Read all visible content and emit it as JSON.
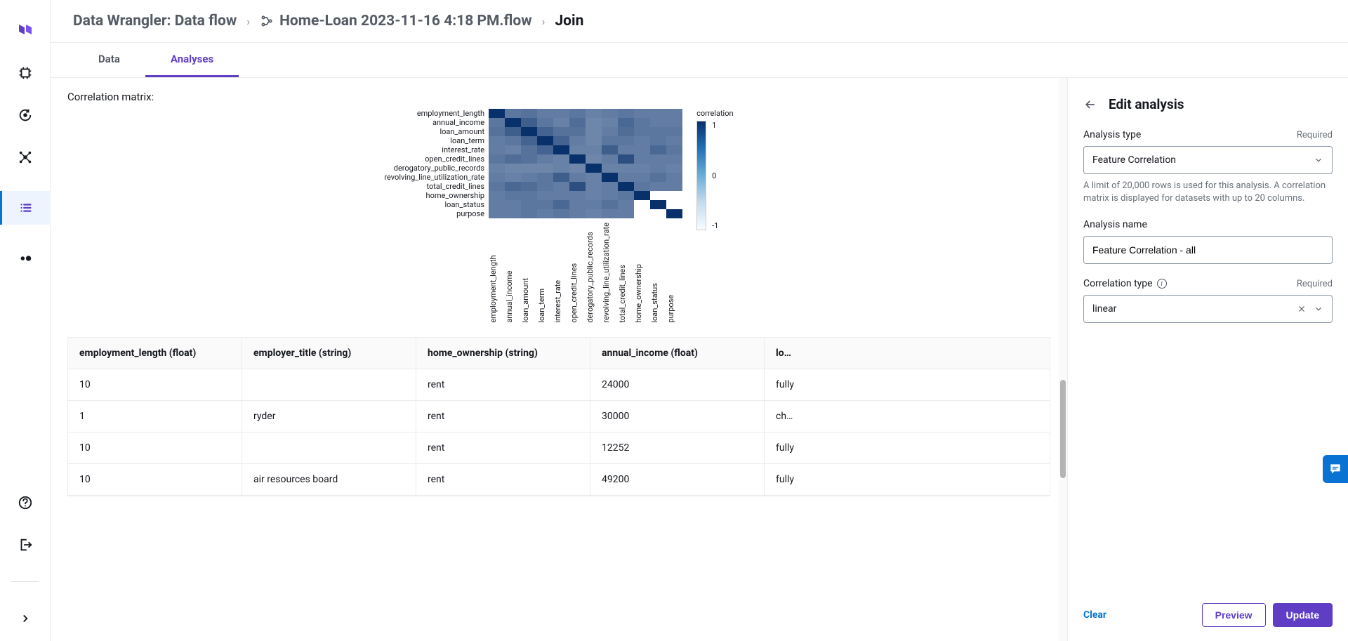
{
  "breadcrumb": {
    "root": "Data Wrangler: Data flow",
    "flow_name": "Home-Loan 2023-11-16 4:18 PM.flow",
    "current": "Join"
  },
  "tabs": {
    "data": "Data",
    "analyses": "Analyses"
  },
  "section": {
    "title": "Correlation matrix:"
  },
  "chart_data": {
    "type": "heatmap",
    "title": "",
    "colorbar_label": "correlation",
    "zmin": -1,
    "zmax": 1,
    "ticks": [
      "1",
      "0",
      "-1"
    ],
    "y_labels": [
      "employment_length",
      "annual_income",
      "loan_amount",
      "loan_term",
      "interest_rate",
      "open_credit_lines",
      "derogatory_public_records",
      "revolving_line_utilization_rate",
      "total_credit_lines",
      "home_ownership",
      "loan_status",
      "purpose"
    ],
    "x_labels": [
      "employment_length",
      "annual_income",
      "loan_amount",
      "loan_term",
      "interest_rate",
      "open_credit_lines",
      "derogatory_public_records",
      "revolving_line_utilization_rate",
      "total_credit_lines",
      "home_ownership",
      "loan_status",
      "purpose"
    ],
    "values": [
      [
        1.0,
        0.3,
        0.35,
        0.25,
        0.25,
        0.3,
        0.2,
        0.25,
        0.3,
        0.25,
        0.25,
        0.25
      ],
      [
        0.3,
        1.0,
        0.55,
        0.3,
        0.2,
        0.4,
        0.15,
        0.2,
        0.45,
        0.3,
        0.25,
        0.25
      ],
      [
        0.35,
        0.55,
        1.0,
        0.5,
        0.35,
        0.35,
        0.15,
        0.25,
        0.4,
        0.3,
        0.3,
        0.3
      ],
      [
        0.25,
        0.3,
        0.5,
        1.0,
        0.5,
        0.25,
        0.15,
        0.3,
        0.3,
        0.25,
        0.3,
        0.25
      ],
      [
        0.25,
        0.2,
        0.35,
        0.5,
        1.0,
        0.2,
        0.2,
        0.55,
        0.25,
        0.25,
        0.45,
        0.3
      ],
      [
        0.3,
        0.4,
        0.35,
        0.25,
        0.2,
        1.0,
        0.15,
        0.25,
        0.7,
        0.25,
        0.25,
        0.25
      ],
      [
        0.2,
        0.15,
        0.15,
        0.15,
        0.2,
        0.15,
        1.0,
        0.2,
        0.2,
        0.2,
        0.25,
        0.2
      ],
      [
        0.25,
        0.2,
        0.25,
        0.3,
        0.55,
        0.25,
        0.2,
        1.0,
        0.25,
        0.25,
        0.35,
        0.25
      ],
      [
        0.3,
        0.45,
        0.4,
        0.3,
        0.25,
        0.7,
        0.2,
        0.25,
        1.0,
        0.3,
        0.25,
        0.25
      ],
      [
        0.25,
        0.3,
        0.3,
        0.25,
        0.25,
        0.25,
        0.2,
        0.25,
        0.3,
        1.0,
        null,
        null
      ],
      [
        0.25,
        0.25,
        0.3,
        0.3,
        0.45,
        0.25,
        0.25,
        0.35,
        0.25,
        null,
        1.0,
        null
      ],
      [
        0.25,
        0.25,
        0.3,
        0.25,
        0.3,
        0.25,
        0.2,
        0.25,
        0.25,
        null,
        null,
        1.0
      ]
    ]
  },
  "table": {
    "columns": [
      "employment_length (float)",
      "employer_title (string)",
      "home_ownership (string)",
      "annual_income (float)",
      "loan_st"
    ],
    "rows": [
      [
        "10",
        "",
        "rent",
        "24000",
        "fully"
      ],
      [
        "1",
        "ryder",
        "rent",
        "30000",
        "charg"
      ],
      [
        "10",
        "",
        "rent",
        "12252",
        "fully"
      ],
      [
        "10",
        "air resources board",
        "rent",
        "49200",
        "fully"
      ]
    ]
  },
  "side_panel": {
    "title": "Edit analysis",
    "analysis_type_label": "Analysis type",
    "analysis_type_value": "Feature Correlation",
    "analysis_type_help": "A limit of 20,000 rows is used for this analysis. A correlation matrix is displayed for datasets with up to 20 columns.",
    "analysis_name_label": "Analysis name",
    "analysis_name_value": "Feature Correlation - all",
    "correlation_type_label": "Correlation type",
    "correlation_type_value": "linear",
    "required_label": "Required",
    "clear": "Clear",
    "preview": "Preview",
    "update": "Update"
  }
}
